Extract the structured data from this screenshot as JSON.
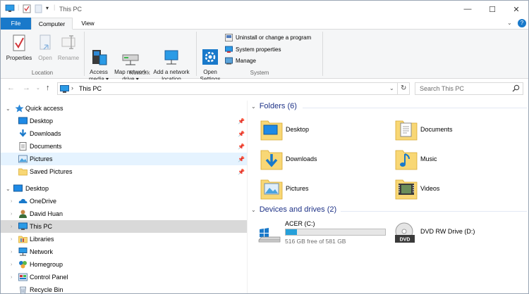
{
  "window": {
    "title": "This PC"
  },
  "tabs": {
    "file": "File",
    "computer": "Computer",
    "view": "View"
  },
  "ribbon": {
    "location": {
      "properties": "Properties",
      "open": "Open",
      "rename": "Rename",
      "label": "Location"
    },
    "network": {
      "access_media": "Access\nmedia ▾",
      "map_network_drive": "Map network\ndrive ▾",
      "add_network_location": "Add a network\nlocation",
      "label": "Network"
    },
    "system": {
      "open_settings": "Open\nSettings",
      "uninstall": "Uninstall or change a program",
      "system_properties": "System properties",
      "manage": "Manage",
      "label": "System"
    }
  },
  "address": {
    "path": "This PC",
    "search_placeholder": "Search This PC"
  },
  "sidebar": {
    "quick_access": "Quick access",
    "quick_items": [
      "Desktop",
      "Downloads",
      "Documents",
      "Pictures",
      "Saved Pictures"
    ],
    "tree": [
      "Desktop",
      "OneDrive",
      "David Huan",
      "This PC",
      "Libraries",
      "Network",
      "Homegroup",
      "Control Panel",
      "Recycle Bin"
    ]
  },
  "content": {
    "folders_header": "Folders (6)",
    "folders": [
      "Desktop",
      "Documents",
      "Downloads",
      "Music",
      "Pictures",
      "Videos"
    ],
    "drives_header": "Devices and drives (2)",
    "drives": [
      {
        "name": "ACER (C:)",
        "free": "516 GB free of 581 GB",
        "used_fraction": 0.11
      },
      {
        "name": "DVD RW Drive (D:)"
      }
    ]
  },
  "colors": {
    "accent": "#1979ca",
    "header_text": "#1e3287",
    "drive_bar": "#26a0da",
    "selection": "#d9d9d9",
    "hover": "#e5f3ff"
  },
  "icons": [
    "computer-icon",
    "properties-icon",
    "folder-icon",
    "pin-icon",
    "star-icon",
    "onedrive-icon",
    "user-icon",
    "library-icon",
    "network-icon",
    "homegroup-icon",
    "control-panel-icon",
    "recycle-bin-icon",
    "gear-icon",
    "windows-drive-icon",
    "dvd-drive-icon"
  ]
}
